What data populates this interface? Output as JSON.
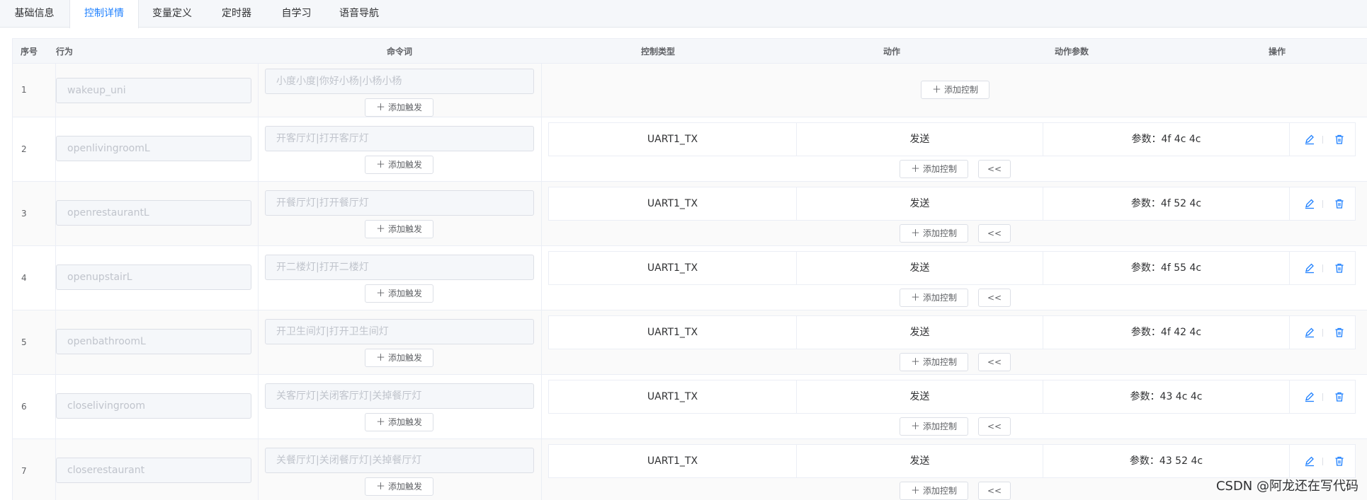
{
  "tabs": [
    "基础信息",
    "控制详情",
    "变量定义",
    "定时器",
    "自学习",
    "语音导航"
  ],
  "active_tab": "控制详情",
  "columns": {
    "index": "序号",
    "behavior": "行为",
    "command": "命令词",
    "control_type": "控制类型",
    "action": "动作",
    "action_param": "动作参数",
    "operation": "操作"
  },
  "buttons": {
    "add_trigger": "添加触发",
    "add_control": "添加控制",
    "collapse": "<<"
  },
  "rows": [
    {
      "index": "1",
      "behavior": "wakeup_uni",
      "command": "小度小度|你好小杨|小杨小杨",
      "controls": []
    },
    {
      "index": "2",
      "behavior": "openlivingroomL",
      "command": "开客厅灯|打开客厅灯",
      "controls": [
        {
          "type": "UART1_TX",
          "action": "发送",
          "param": "参数：4f 4c 4c"
        }
      ]
    },
    {
      "index": "3",
      "behavior": "openrestaurantL",
      "command": "开餐厅灯|打开餐厅灯",
      "controls": [
        {
          "type": "UART1_TX",
          "action": "发送",
          "param": "参数：4f 52 4c"
        }
      ]
    },
    {
      "index": "4",
      "behavior": "openupstairL",
      "command": "开二楼灯|打开二楼灯",
      "controls": [
        {
          "type": "UART1_TX",
          "action": "发送",
          "param": "参数：4f 55 4c"
        }
      ]
    },
    {
      "index": "5",
      "behavior": "openbathroomL",
      "command": "开卫生间灯|打开卫生间灯",
      "controls": [
        {
          "type": "UART1_TX",
          "action": "发送",
          "param": "参数：4f 42 4c"
        }
      ]
    },
    {
      "index": "6",
      "behavior": "closelivingroom",
      "command": "关客厅灯|关闭客厅灯|关掉餐厅灯",
      "controls": [
        {
          "type": "UART1_TX",
          "action": "发送",
          "param": "参数：43 4c 4c"
        }
      ]
    },
    {
      "index": "7",
      "behavior": "closerestaurant",
      "command": "关餐厅灯|关闭餐厅灯|关掉餐厅灯",
      "controls": [
        {
          "type": "UART1_TX",
          "action": "发送",
          "param": "参数：43 52 4c"
        }
      ]
    }
  ],
  "watermark": "CSDN @阿龙还在写代码",
  "colors": {
    "accent": "#1e80ff",
    "header_bg": "#f5f7fa",
    "border": "#ebeef5"
  }
}
